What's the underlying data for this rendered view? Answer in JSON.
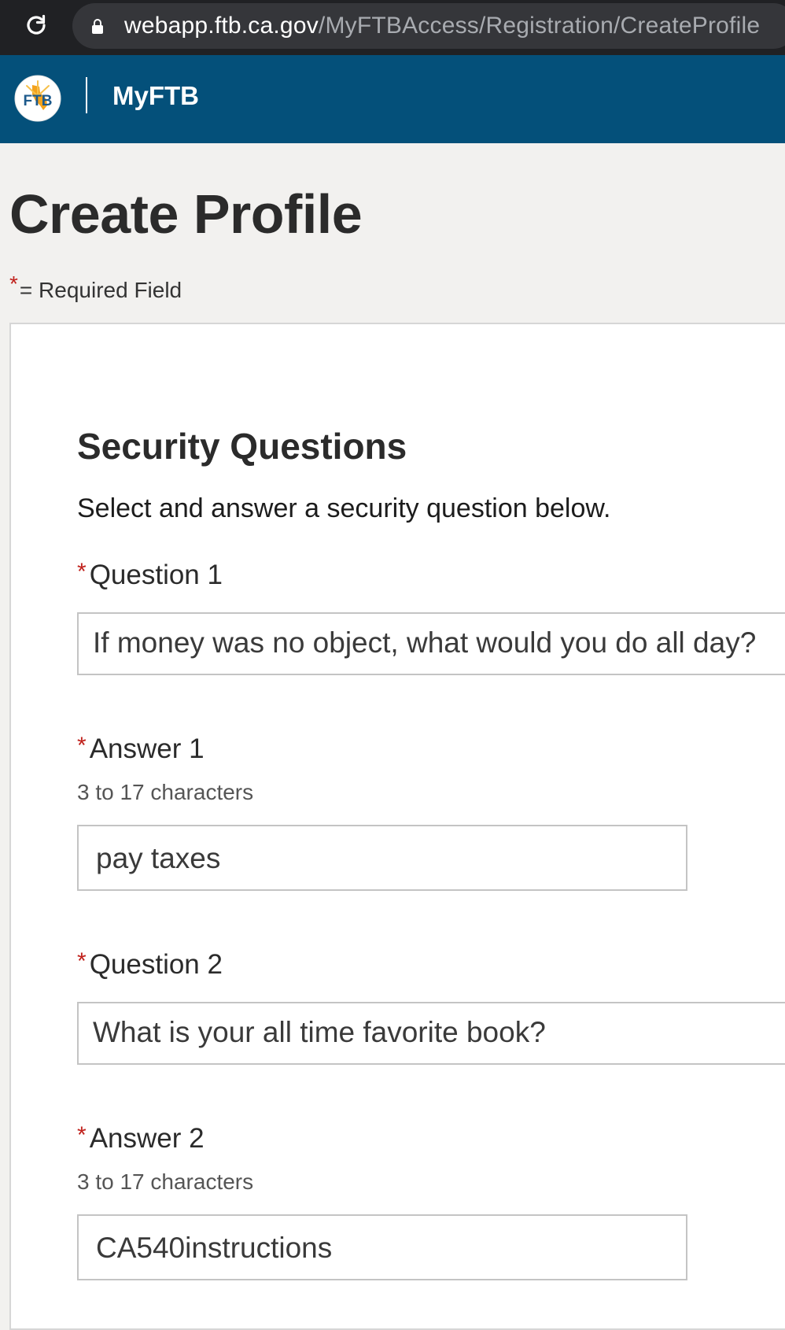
{
  "browser": {
    "url_host": "webapp.ftb.ca.gov",
    "url_path": "/MyFTBAccess/Registration/CreateProfile"
  },
  "header": {
    "logo_text": "FTB",
    "app_name": "MyFTB"
  },
  "page": {
    "title": "Create Profile",
    "required_star": "*",
    "required_note": "= Required Field"
  },
  "security": {
    "title": "Security Questions",
    "subtitle": "Select and answer a security question below.",
    "fields": [
      {
        "star": "*",
        "label": "Question 1",
        "value": "If money was no object, what would you do all day?"
      },
      {
        "star": "*",
        "label": "Answer 1",
        "hint": "3 to 17 characters",
        "value": "pay taxes"
      },
      {
        "star": "*",
        "label": "Question 2",
        "value": "What is your all time favorite book?"
      },
      {
        "star": "*",
        "label": "Answer 2",
        "hint": "3 to 17 characters",
        "value": "CA540instructions"
      }
    ]
  },
  "colors": {
    "header_bg": "#04507a",
    "required_star": "#c0211c",
    "page_bg": "#f2f1ef"
  },
  "icons": [
    "reload-icon",
    "lock-icon",
    "ftb-logo"
  ]
}
